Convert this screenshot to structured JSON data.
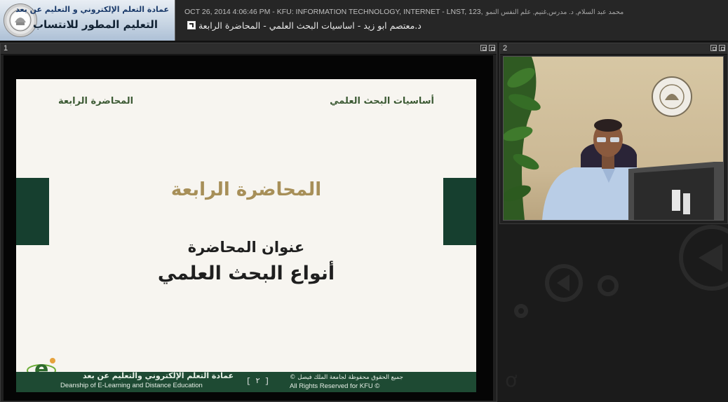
{
  "header": {
    "logo_top": "عمادة التعلم الإلكتروني و التعليم عن بعد",
    "logo_bottom": "التعليم المطور للانتساب",
    "meta": "OCT 26, 2014 4:06:46 PM - KFU: INFORMATION TECHNOLOGY, INTERNET - LNST, 123,",
    "names": "محمد عبد السلام, د. مدرس,غنيم, علم النفس النمو",
    "title": "د.معتصم ابو زيد - اساسيات البحث العلمي - المحاضرة الرابعة"
  },
  "pods": [
    {
      "number": "1"
    },
    {
      "number": "2"
    }
  ],
  "slide": {
    "header_right": "أساسيات البحث العلمي",
    "header_left": "المحاضرة الرابعة",
    "big_title": "المحاضرة الرابعة",
    "subtitle": "عنوان المحاضرة",
    "main_title": "أنواع البحث العلمي",
    "footer_deanship_ar": "عمادة التعلم الإلكتروني والتعليم عن بعد",
    "footer_deanship_en": "Deanship of E-Learning and Distance Education",
    "page_number": "[ ٢ ]",
    "footer_copyright_ar": "جميع الحقوق محفوظة لجامعة الملك فيصل ©",
    "footer_copyright_en": "All Rights Reserved for KFU ©"
  },
  "colors": {
    "background": "#1b1b1b",
    "slide_green": "#1e4a33",
    "slide_gold": "#a78f58"
  }
}
